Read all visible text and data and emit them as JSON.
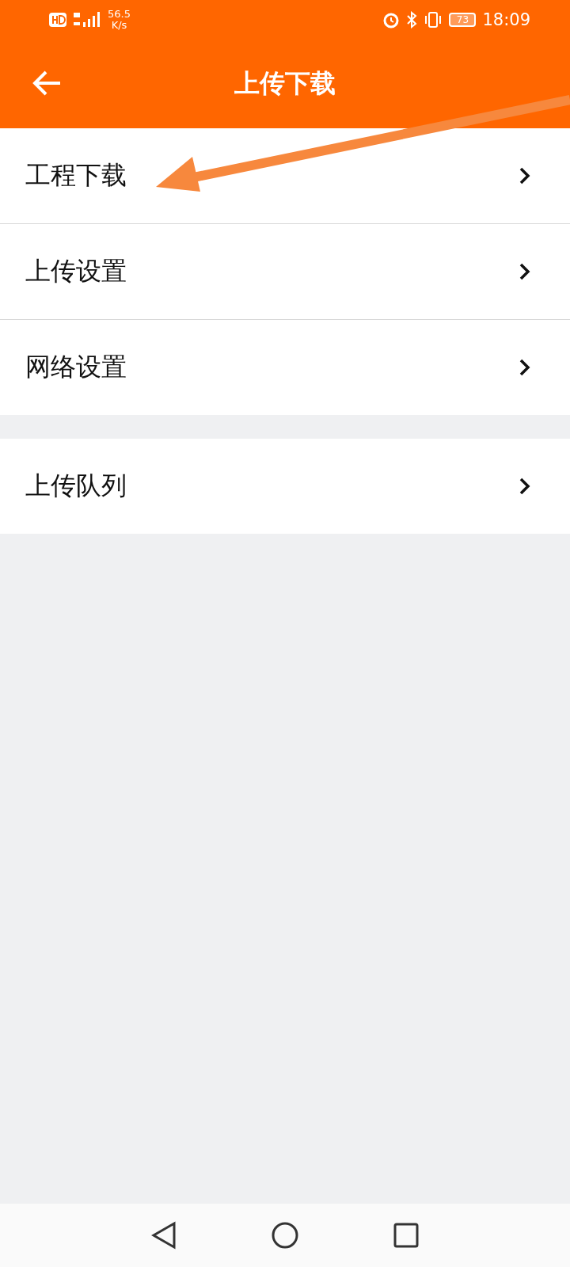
{
  "status_bar": {
    "speed": "56.5",
    "speed_unit": "K/s",
    "battery": "73",
    "time": "18:09"
  },
  "header": {
    "title": "上传下载"
  },
  "sections": [
    {
      "items": [
        {
          "label": "工程下载"
        },
        {
          "label": "上传设置"
        },
        {
          "label": "网络设置"
        }
      ]
    },
    {
      "items": [
        {
          "label": "上传队列"
        }
      ]
    }
  ]
}
